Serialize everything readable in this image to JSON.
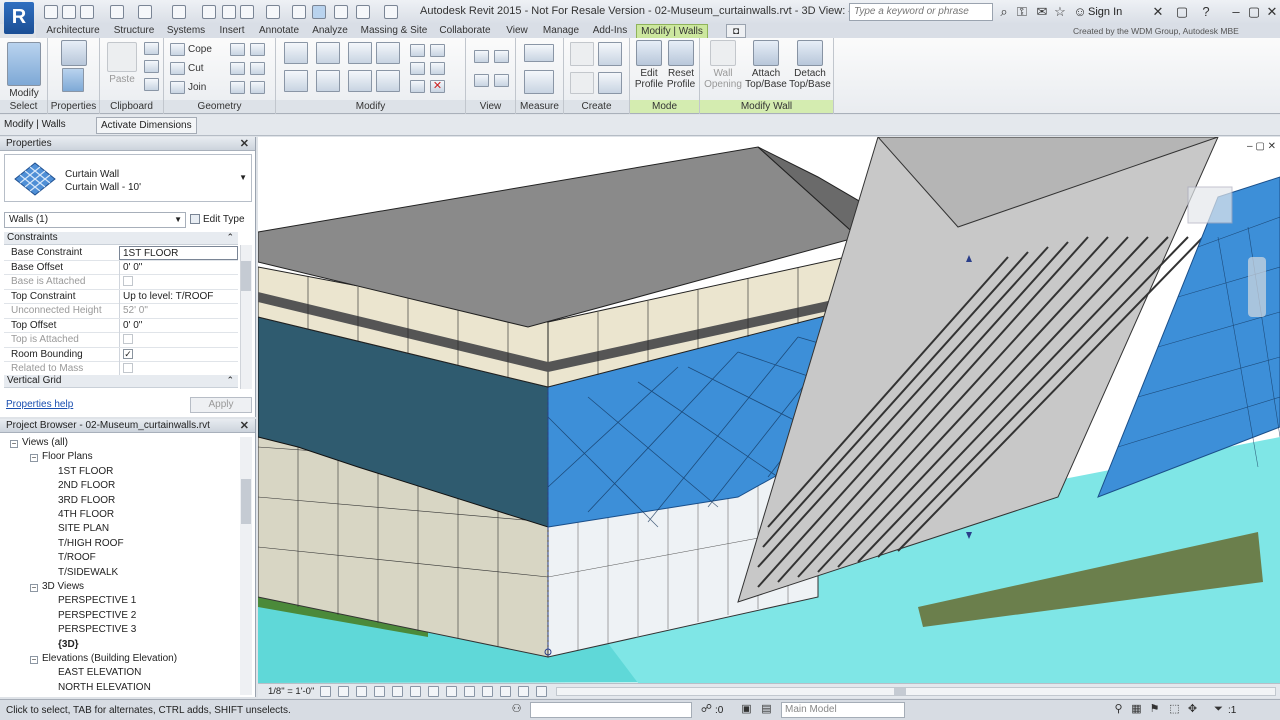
{
  "app": {
    "logo": "R",
    "title": "Autodesk Revit 2015 - Not For Resale Version -    02-Museum_curtainwalls.rvt - 3D View: {3D}",
    "search_placeholder": "Type a keyword or phrase",
    "sign_in": "Sign In",
    "credit": "Created by the WDM Group, Autodesk MBE"
  },
  "tabs": [
    "Architecture",
    "Structure",
    "Systems",
    "Insert",
    "Annotate",
    "Analyze",
    "Massing & Site",
    "Collaborate",
    "View",
    "Manage",
    "Add-Ins",
    "Modify | Walls"
  ],
  "active_tab": "Modify | Walls",
  "ribbon": {
    "select": {
      "modify": "Modify",
      "label": "Select"
    },
    "properties": {
      "btn": "Properties",
      "label": "Properties"
    },
    "clipboard": {
      "paste": "Paste",
      "label": "Clipboard"
    },
    "geometry": {
      "cope": "Cope",
      "cut": "Cut",
      "join": "Join",
      "label": "Geometry"
    },
    "modify": {
      "label": "Modify"
    },
    "view": {
      "label": "View"
    },
    "measure": {
      "label": "Measure"
    },
    "create": {
      "label": "Create"
    },
    "mode": {
      "edit_profile": [
        "Edit",
        "Profile"
      ],
      "reset_profile": [
        "Reset",
        "Profile"
      ],
      "label": "Mode"
    },
    "modify_wall": {
      "wall_opening": [
        "Wall",
        "Opening"
      ],
      "attach": [
        "Attach",
        "Top/Base"
      ],
      "detach": [
        "Detach",
        "Top/Base"
      ],
      "label": "Modify Wall"
    }
  },
  "context_bar": {
    "title": "Modify | Walls",
    "activate": "Activate Dimensions"
  },
  "properties": {
    "header": "Properties",
    "type_family": "Curtain Wall",
    "type_name": "Curtain Wall - 10'",
    "selector": "Walls (1)",
    "edit_type": "Edit Type",
    "constraints_label": "Constraints",
    "rows": [
      {
        "key": "Base Constraint",
        "value": "1ST FLOOR",
        "disabled": false,
        "checkbox": false
      },
      {
        "key": "Base Offset",
        "value": "0'  0\"",
        "disabled": false,
        "checkbox": false
      },
      {
        "key": "Base is Attached",
        "value": "",
        "disabled": true,
        "checkbox": true,
        "checked": false
      },
      {
        "key": "Top Constraint",
        "value": "Up to level: T/ROOF",
        "disabled": false,
        "checkbox": false
      },
      {
        "key": "Unconnected Height",
        "value": "52'  0\"",
        "disabled": true,
        "checkbox": false
      },
      {
        "key": "Top Offset",
        "value": "0'  0\"",
        "disabled": false,
        "checkbox": false
      },
      {
        "key": "Top is Attached",
        "value": "",
        "disabled": true,
        "checkbox": true,
        "checked": false
      },
      {
        "key": "Room Bounding",
        "value": "",
        "disabled": false,
        "checkbox": true,
        "checked": true
      },
      {
        "key": "Related to Mass",
        "value": "",
        "disabled": true,
        "checkbox": true,
        "checked": false
      }
    ],
    "vertical_grid_label": "Vertical Grid",
    "help": "Properties help",
    "apply": "Apply"
  },
  "browser": {
    "header": "Project Browser - 02-Museum_curtainwalls.rvt",
    "views_all": "Views (all)",
    "floor_plans": "Floor Plans",
    "floor_plan_items": [
      "1ST FLOOR",
      "2ND FLOOR",
      "3RD FLOOR",
      "4TH FLOOR",
      "SITE PLAN",
      "T/HIGH ROOF",
      "T/ROOF",
      "T/SIDEWALK"
    ],
    "views_3d": "3D Views",
    "views_3d_items": [
      "PERSPECTIVE 1",
      "PERSPECTIVE 2",
      "PERSPECTIVE 3",
      "{3D}"
    ],
    "elevations": "Elevations (Building Elevation)",
    "elevation_items": [
      "EAST ELEVATION",
      "NORTH ELEVATION"
    ]
  },
  "view_control": {
    "scale": "1/8\" = 1'-0\""
  },
  "status": {
    "message": "Click to select, TAB for alternates, CTRL adds, SHIFT unselects.",
    "count": ":0",
    "main_model": "Main Model"
  }
}
